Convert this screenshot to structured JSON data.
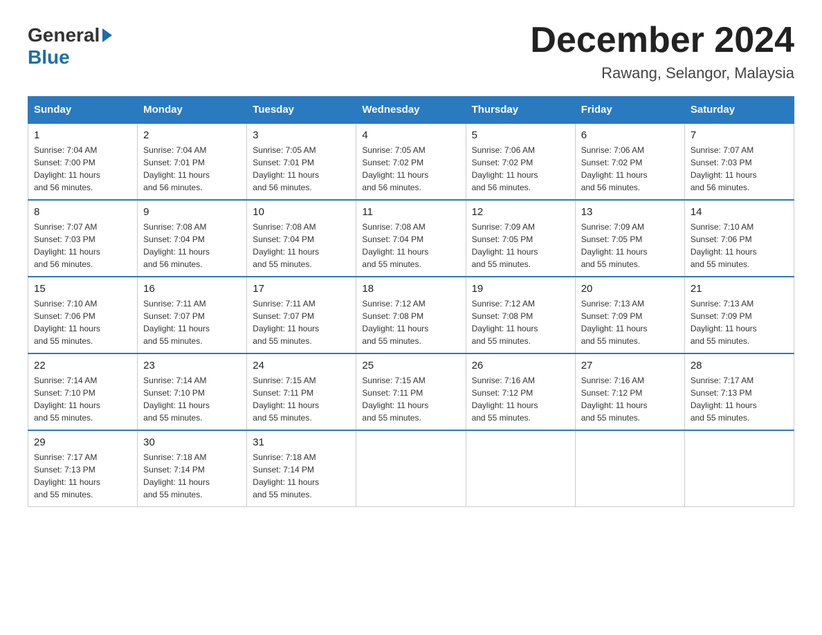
{
  "logo": {
    "general": "General",
    "blue": "Blue"
  },
  "title": {
    "month": "December 2024",
    "location": "Rawang, Selangor, Malaysia"
  },
  "weekdays": [
    "Sunday",
    "Monday",
    "Tuesday",
    "Wednesday",
    "Thursday",
    "Friday",
    "Saturday"
  ],
  "weeks": [
    [
      {
        "day": "1",
        "sunrise": "7:04 AM",
        "sunset": "7:00 PM",
        "daylight": "11 hours and 56 minutes."
      },
      {
        "day": "2",
        "sunrise": "7:04 AM",
        "sunset": "7:01 PM",
        "daylight": "11 hours and 56 minutes."
      },
      {
        "day": "3",
        "sunrise": "7:05 AM",
        "sunset": "7:01 PM",
        "daylight": "11 hours and 56 minutes."
      },
      {
        "day": "4",
        "sunrise": "7:05 AM",
        "sunset": "7:02 PM",
        "daylight": "11 hours and 56 minutes."
      },
      {
        "day": "5",
        "sunrise": "7:06 AM",
        "sunset": "7:02 PM",
        "daylight": "11 hours and 56 minutes."
      },
      {
        "day": "6",
        "sunrise": "7:06 AM",
        "sunset": "7:02 PM",
        "daylight": "11 hours and 56 minutes."
      },
      {
        "day": "7",
        "sunrise": "7:07 AM",
        "sunset": "7:03 PM",
        "daylight": "11 hours and 56 minutes."
      }
    ],
    [
      {
        "day": "8",
        "sunrise": "7:07 AM",
        "sunset": "7:03 PM",
        "daylight": "11 hours and 56 minutes."
      },
      {
        "day": "9",
        "sunrise": "7:08 AM",
        "sunset": "7:04 PM",
        "daylight": "11 hours and 56 minutes."
      },
      {
        "day": "10",
        "sunrise": "7:08 AM",
        "sunset": "7:04 PM",
        "daylight": "11 hours and 55 minutes."
      },
      {
        "day": "11",
        "sunrise": "7:08 AM",
        "sunset": "7:04 PM",
        "daylight": "11 hours and 55 minutes."
      },
      {
        "day": "12",
        "sunrise": "7:09 AM",
        "sunset": "7:05 PM",
        "daylight": "11 hours and 55 minutes."
      },
      {
        "day": "13",
        "sunrise": "7:09 AM",
        "sunset": "7:05 PM",
        "daylight": "11 hours and 55 minutes."
      },
      {
        "day": "14",
        "sunrise": "7:10 AM",
        "sunset": "7:06 PM",
        "daylight": "11 hours and 55 minutes."
      }
    ],
    [
      {
        "day": "15",
        "sunrise": "7:10 AM",
        "sunset": "7:06 PM",
        "daylight": "11 hours and 55 minutes."
      },
      {
        "day": "16",
        "sunrise": "7:11 AM",
        "sunset": "7:07 PM",
        "daylight": "11 hours and 55 minutes."
      },
      {
        "day": "17",
        "sunrise": "7:11 AM",
        "sunset": "7:07 PM",
        "daylight": "11 hours and 55 minutes."
      },
      {
        "day": "18",
        "sunrise": "7:12 AM",
        "sunset": "7:08 PM",
        "daylight": "11 hours and 55 minutes."
      },
      {
        "day": "19",
        "sunrise": "7:12 AM",
        "sunset": "7:08 PM",
        "daylight": "11 hours and 55 minutes."
      },
      {
        "day": "20",
        "sunrise": "7:13 AM",
        "sunset": "7:09 PM",
        "daylight": "11 hours and 55 minutes."
      },
      {
        "day": "21",
        "sunrise": "7:13 AM",
        "sunset": "7:09 PM",
        "daylight": "11 hours and 55 minutes."
      }
    ],
    [
      {
        "day": "22",
        "sunrise": "7:14 AM",
        "sunset": "7:10 PM",
        "daylight": "11 hours and 55 minutes."
      },
      {
        "day": "23",
        "sunrise": "7:14 AM",
        "sunset": "7:10 PM",
        "daylight": "11 hours and 55 minutes."
      },
      {
        "day": "24",
        "sunrise": "7:15 AM",
        "sunset": "7:11 PM",
        "daylight": "11 hours and 55 minutes."
      },
      {
        "day": "25",
        "sunrise": "7:15 AM",
        "sunset": "7:11 PM",
        "daylight": "11 hours and 55 minutes."
      },
      {
        "day": "26",
        "sunrise": "7:16 AM",
        "sunset": "7:12 PM",
        "daylight": "11 hours and 55 minutes."
      },
      {
        "day": "27",
        "sunrise": "7:16 AM",
        "sunset": "7:12 PM",
        "daylight": "11 hours and 55 minutes."
      },
      {
        "day": "28",
        "sunrise": "7:17 AM",
        "sunset": "7:13 PM",
        "daylight": "11 hours and 55 minutes."
      }
    ],
    [
      {
        "day": "29",
        "sunrise": "7:17 AM",
        "sunset": "7:13 PM",
        "daylight": "11 hours and 55 minutes."
      },
      {
        "day": "30",
        "sunrise": "7:18 AM",
        "sunset": "7:14 PM",
        "daylight": "11 hours and 55 minutes."
      },
      {
        "day": "31",
        "sunrise": "7:18 AM",
        "sunset": "7:14 PM",
        "daylight": "11 hours and 55 minutes."
      },
      null,
      null,
      null,
      null
    ]
  ],
  "labels": {
    "sunrise": "Sunrise:",
    "sunset": "Sunset:",
    "daylight": "Daylight:"
  }
}
